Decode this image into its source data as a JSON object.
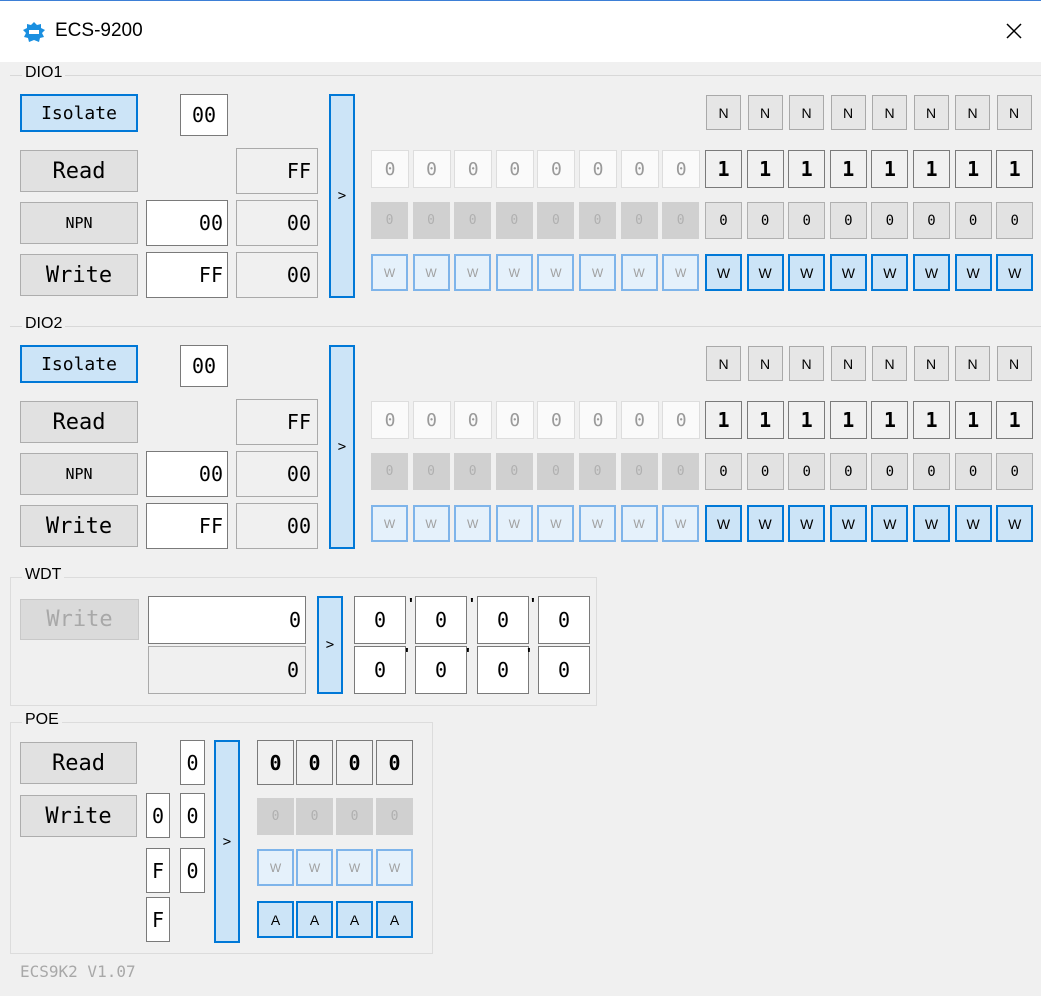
{
  "window": {
    "title": "ECS-9200",
    "icon": "app-logo-icon",
    "close_icon": "close-icon"
  },
  "dio1": {
    "label": "DIO1",
    "isolate_label": "Isolate",
    "isolate_value": "00",
    "read_label": "Read",
    "read_value": "FF",
    "npn_label": "NPN",
    "npn_input": "00",
    "npn_value": "00",
    "write_label": "Write",
    "write_input": "FF",
    "write_value": "00",
    "arrow": ">",
    "n_row": [
      "N",
      "N",
      "N",
      "N",
      "N",
      "N",
      "N",
      "N"
    ],
    "read_bits": [
      "0",
      "0",
      "0",
      "0",
      "0",
      "0",
      "0",
      "0",
      "1",
      "1",
      "1",
      "1",
      "1",
      "1",
      "1",
      "1"
    ],
    "npn_bits": [
      "0",
      "0",
      "0",
      "0",
      "0",
      "0",
      "0",
      "0",
      "0",
      "0",
      "0",
      "0",
      "0",
      "0",
      "0",
      "0"
    ],
    "write_bits": [
      "W",
      "W",
      "W",
      "W",
      "W",
      "W",
      "W",
      "W",
      "W",
      "W",
      "W",
      "W",
      "W",
      "W",
      "W",
      "W"
    ]
  },
  "dio2": {
    "label": "DIO2",
    "isolate_label": "Isolate",
    "isolate_value": "00",
    "read_label": "Read",
    "read_value": "FF",
    "npn_label": "NPN",
    "npn_input": "00",
    "npn_value": "00",
    "write_label": "Write",
    "write_input": "FF",
    "write_value": "00",
    "arrow": ">",
    "n_row": [
      "N",
      "N",
      "N",
      "N",
      "N",
      "N",
      "N",
      "N"
    ],
    "read_bits": [
      "0",
      "0",
      "0",
      "0",
      "0",
      "0",
      "0",
      "0",
      "1",
      "1",
      "1",
      "1",
      "1",
      "1",
      "1",
      "1"
    ],
    "npn_bits": [
      "0",
      "0",
      "0",
      "0",
      "0",
      "0",
      "0",
      "0",
      "0",
      "0",
      "0",
      "0",
      "0",
      "0",
      "0",
      "0"
    ],
    "write_bits": [
      "W",
      "W",
      "W",
      "W",
      "W",
      "W",
      "W",
      "W",
      "W",
      "W",
      "W",
      "W",
      "W",
      "W",
      "W",
      "W"
    ]
  },
  "wdt": {
    "label": "WDT",
    "write_label": "Write",
    "input1": "0",
    "input2": "0",
    "arrow": ">",
    "row1": [
      "0",
      "0",
      "0",
      "0"
    ],
    "row2": [
      "0",
      "0",
      "0",
      "0"
    ]
  },
  "poe": {
    "label": "POE",
    "read_label": "Read",
    "write_label": "Write",
    "read_value": "0",
    "write_col1": [
      "0",
      "F",
      "F"
    ],
    "write_col2": [
      "0",
      "0"
    ],
    "arrow": ">",
    "read_bits": [
      "0",
      "0",
      "0",
      "0"
    ],
    "npn_bits": [
      "0",
      "0",
      "0",
      "0"
    ],
    "write_bits": [
      "W",
      "W",
      "W",
      "W"
    ],
    "auto_bits": [
      "A",
      "A",
      "A",
      "A"
    ]
  },
  "footer": {
    "version": "ECS9K2 V1.07"
  },
  "colors": {
    "accent": "#0078d7",
    "accent_fill": "#cce4f7",
    "background": "#f0f0f0"
  }
}
